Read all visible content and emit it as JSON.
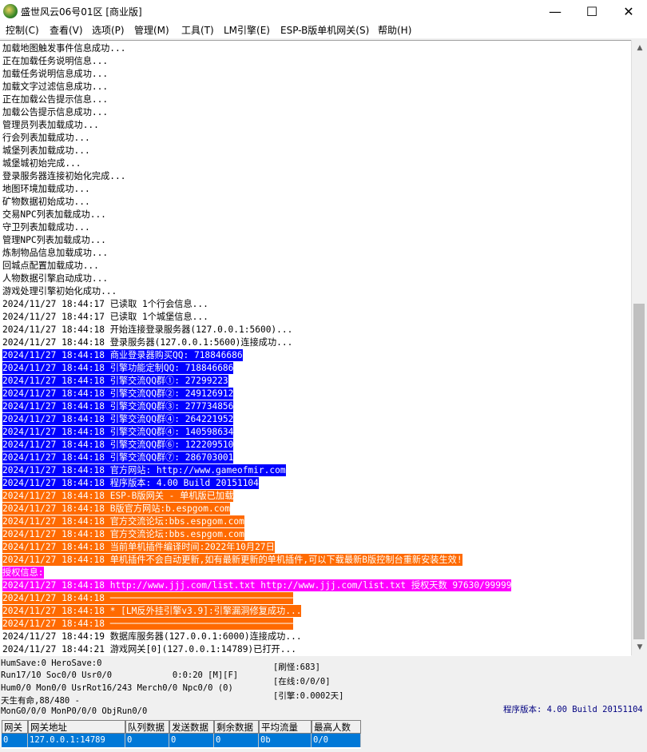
{
  "window": {
    "title": "盛世风云06号01区 [商业版]",
    "minimize": "—",
    "maximize": "☐",
    "close": "✕"
  },
  "menu": [
    "控制(C)",
    "查看(V)",
    "选项(P)",
    "管理(M)",
    "工具(T)",
    "LM引擎(E)",
    "ESP-B版单机网关(S)",
    "帮助(H)"
  ],
  "log": [
    {
      "text": "加载地图触发事件信息成功...",
      "bg": null,
      "fg": "#000000"
    },
    {
      "text": "正在加载任务说明信息...",
      "bg": null,
      "fg": "#000000"
    },
    {
      "text": "加载任务说明信息成功...",
      "bg": null,
      "fg": "#000000"
    },
    {
      "text": "加载文字过滤信息成功...",
      "bg": null,
      "fg": "#000000"
    },
    {
      "text": "正在加载公告提示信息...",
      "bg": null,
      "fg": "#000000"
    },
    {
      "text": "加载公告提示信息成功...",
      "bg": null,
      "fg": "#000000"
    },
    {
      "text": "管理员列表加载成功...",
      "bg": null,
      "fg": "#000000"
    },
    {
      "text": "行会列表加载成功...",
      "bg": null,
      "fg": "#000000"
    },
    {
      "text": "城堡列表加载成功...",
      "bg": null,
      "fg": "#000000"
    },
    {
      "text": "城堡城初始完成...",
      "bg": null,
      "fg": "#000000"
    },
    {
      "text": "登录服务器连接初始化完成...",
      "bg": null,
      "fg": "#000000"
    },
    {
      "text": "地图环境加载成功...",
      "bg": null,
      "fg": "#000000"
    },
    {
      "text": "矿物数据初始成功...",
      "bg": null,
      "fg": "#000000"
    },
    {
      "text": "交易NPC列表加载成功...",
      "bg": null,
      "fg": "#000000"
    },
    {
      "text": "守卫列表加载成功...",
      "bg": null,
      "fg": "#000000"
    },
    {
      "text": "管理NPC列表加载成功...",
      "bg": null,
      "fg": "#000000"
    },
    {
      "text": "炼制物品信息加载成功...",
      "bg": null,
      "fg": "#000000"
    },
    {
      "text": "回城点配置加载成功...",
      "bg": null,
      "fg": "#000000"
    },
    {
      "text": "人物数据引擎启动成功...",
      "bg": null,
      "fg": "#000000"
    },
    {
      "text": "游戏处理引擎初始化成功...",
      "bg": null,
      "fg": "#000000"
    },
    {
      "text": "2024/11/27 18:44:17 已读取 1个行会信息...",
      "bg": null,
      "fg": "#000000"
    },
    {
      "text": "2024/11/27 18:44:17 已读取 1个城堡信息...",
      "bg": null,
      "fg": "#000000"
    },
    {
      "text": "2024/11/27 18:44:18 开始连接登录服务器(127.0.0.1:5600)...",
      "bg": null,
      "fg": "#000000"
    },
    {
      "text": "2024/11/27 18:44:18 登录服务器(127.0.0.1:5600)连接成功...",
      "bg": null,
      "fg": "#000000"
    },
    {
      "text": "2024/11/27 18:44:18 商业登录器购买QQ: 718846686",
      "bg": "#0000ff",
      "fg": "#ffffff"
    },
    {
      "text": "2024/11/27 18:44:18 引擎功能定制QQ: 718846686",
      "bg": "#0000ff",
      "fg": "#ffffff"
    },
    {
      "text": "2024/11/27 18:44:18 引擎交流QQ群①: 27299223",
      "bg": "#0000ff",
      "fg": "#ffffff"
    },
    {
      "text": "2024/11/27 18:44:18 引擎交流QQ群②: 249126912",
      "bg": "#0000ff",
      "fg": "#ffffff"
    },
    {
      "text": "2024/11/27 18:44:18 引擎交流QQ群③: 277734856",
      "bg": "#0000ff",
      "fg": "#ffffff"
    },
    {
      "text": "2024/11/27 18:44:18 引擎交流QQ群④: 264221952",
      "bg": "#0000ff",
      "fg": "#ffffff"
    },
    {
      "text": "2024/11/27 18:44:18 引擎交流QQ群④: 140598634",
      "bg": "#0000ff",
      "fg": "#ffffff"
    },
    {
      "text": "2024/11/27 18:44:18 引擎交流QQ群⑥: 122209510",
      "bg": "#0000ff",
      "fg": "#ffffff"
    },
    {
      "text": "2024/11/27 18:44:18 引擎交流QQ群⑦: 286703001",
      "bg": "#0000ff",
      "fg": "#ffffff"
    },
    {
      "text": "2024/11/27 18:44:18 官方网站: http://www.gameofmir.com",
      "bg": "#0000ff",
      "fg": "#ffffff"
    },
    {
      "text": "2024/11/27 18:44:18 程序版本: 4.00 Build 20151104",
      "bg": "#0000ff",
      "fg": "#ffffff"
    },
    {
      "text": "2024/11/27 18:44:18 ESP-B版网关 - 单机版已加载",
      "bg": "#ff6a00",
      "fg": "#ffffff"
    },
    {
      "text": "2024/11/27 18:44:18 B版官方网站:b.espgom.com",
      "bg": "#ff6a00",
      "fg": "#ffffff"
    },
    {
      "text": "2024/11/27 18:44:18 官方交流论坛:bbs.espgom.com",
      "bg": "#ff6a00",
      "fg": "#ffffff"
    },
    {
      "text": "2024/11/27 18:44:18 官方交流论坛:bbs.espgom.com",
      "bg": "#ff6a00",
      "fg": "#ffffff"
    },
    {
      "text": "2024/11/27 18:44:18 当前单机插件编译时间:2022年10月27日",
      "bg": "#ff6a00",
      "fg": "#ffffff"
    },
    {
      "text": "2024/11/27 18:44:18 单机插件不会自动更新,如有最新更新的单机插件,可以下载最新B版控制台重新安装生效!",
      "bg": "#ff6a00",
      "fg": "#ffffff"
    },
    {
      "text": "授权信息:",
      "bg": "#ff00ff",
      "fg": "#ffffff"
    },
    {
      "text": "2024/11/27 18:44:18 http://www.jjj.com/list.txt http://www.jjj.com/list.txt 授权天数 97630/99999",
      "bg": "#ff00ff",
      "fg": "#ffffff"
    },
    {
      "text": "2024/11/27 18:44:18 ──────────────────────────────────",
      "bg": "#ff6a00",
      "fg": "#ffffff"
    },
    {
      "text": "2024/11/27 18:44:18 * [LM反外挂引擎v3.9]:引擎漏洞修复成功...",
      "bg": "#ff6a00",
      "fg": "#ffffff"
    },
    {
      "text": "2024/11/27 18:44:18 ──────────────────────────────────",
      "bg": "#ff6a00",
      "fg": "#ffffff"
    },
    {
      "text": "2024/11/27 18:44:19 数据库服务器(127.0.0.1:6000)连接成功...",
      "bg": null,
      "fg": "#000000"
    },
    {
      "text": "2024/11/27 18:44:21 游戏网关[0](127.0.0.1:14789)已打开...",
      "bg": null,
      "fg": "#000000"
    }
  ],
  "status": {
    "line1": "HumSave:0 HeroSave:0",
    "line2": "Run17/10 Soc0/0 Usr0/0            0:0:20 [M][F]",
    "line3": "Hum0/0 Mon0/0 UsrRot16/243 Merch0/0 Npc0/0 (0)",
    "line4": "天生有命,88/480 -",
    "line5": "MonG0/0/0 MonP0/0/0 ObjRun0/0",
    "refresh_monster": "[刷怪:683]",
    "online": "[在线:0/0/0]",
    "engine": "[引擎:0.0002天]",
    "version": "程序版本: 4.00 Build 20151104"
  },
  "gateway_table": {
    "headers": [
      "网关",
      "网关地址",
      "队列数据",
      "发送数据",
      "剩余数据",
      "平均流量",
      "最高人数"
    ],
    "rows": [
      [
        "0",
        "127.0.0.1:14789",
        "0",
        "0",
        "0",
        "0b",
        "0/0"
      ]
    ]
  },
  "colors": {
    "selection_blue": "#0078d7",
    "log_blue": "#0000ff",
    "log_orange": "#ff6a00",
    "log_magenta": "#ff00ff",
    "version_blue": "#000080"
  }
}
